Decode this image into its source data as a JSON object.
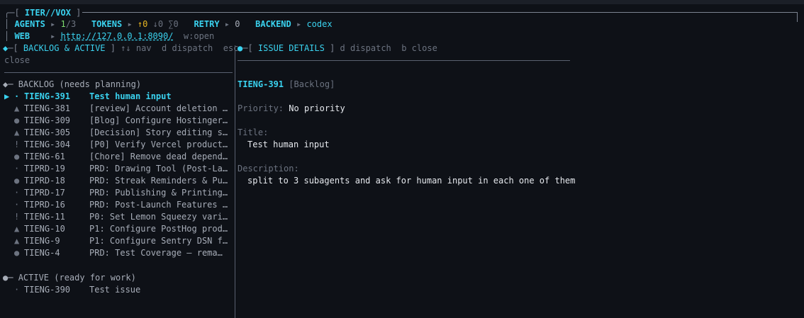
{
  "header": {
    "app_title": "ITER//VOX",
    "agents_label": "AGENTS",
    "agents_active": "1",
    "agents_total": "/3",
    "tokens_label": "TOKENS",
    "tokens_up": "↑0",
    "tokens_down": "↓0",
    "tokens_sum": "∑0",
    "retry_label": "RETRY",
    "retry_value": "0",
    "backend_label": "BACKEND",
    "backend_value": "codex",
    "web_label": "WEB",
    "web_url": "http://127.0.0.1:8090/",
    "web_hint": "w:open"
  },
  "left_panel": {
    "title": "BACKLOG & ACTIVE",
    "hint_nav": "↑↓ nav",
    "hint_dispatch": "d dispatch",
    "hint_esc": "esc",
    "hint_close": "close",
    "backlog_heading": "BACKLOG (needs planning)",
    "backlog": [
      {
        "icon": "·",
        "id": "TIENG-391",
        "title": "Test human input",
        "selected": true
      },
      {
        "icon": "▲",
        "id": "TIENG-381",
        "title": "[review] Account deletion m…",
        "selected": false
      },
      {
        "icon": "●",
        "id": "TIENG-309",
        "title": "[Blog] Configure Hostinger …",
        "selected": false
      },
      {
        "icon": "▲",
        "id": "TIENG-305",
        "title": "[Decision] Story editing sc…",
        "selected": false
      },
      {
        "icon": "!",
        "id": "TIENG-304",
        "title": "[P0] Verify Vercel producti…",
        "selected": false
      },
      {
        "icon": "●",
        "id": "TIENG-61",
        "title": "[Chore] Remove dead depende…",
        "selected": false
      },
      {
        "icon": "·",
        "id": "TIPRD-19",
        "title": "PRD: Drawing Tool (Post-Lau…",
        "selected": false
      },
      {
        "icon": "●",
        "id": "TIPRD-18",
        "title": "PRD: Streak Reminders & Pus…",
        "selected": false
      },
      {
        "icon": "·",
        "id": "TIPRD-17",
        "title": "PRD: Publishing & Printing …",
        "selected": false
      },
      {
        "icon": "·",
        "id": "TIPRD-16",
        "title": "PRD: Post-Launch Features B…",
        "selected": false
      },
      {
        "icon": "!",
        "id": "TIENG-11",
        "title": "P0: Set Lemon Squeezy varia…",
        "selected": false
      },
      {
        "icon": "▲",
        "id": "TIENG-10",
        "title": "P1: Configure PostHog produ…",
        "selected": false
      },
      {
        "icon": "▲",
        "id": "TIENG-9",
        "title": "P1: Configure Sentry DSN fo…",
        "selected": false
      },
      {
        "icon": "●",
        "id": "TIENG-4",
        "title": "PRD: Test Coverage — rema…",
        "selected": false
      }
    ],
    "active_heading": "ACTIVE (ready for work)",
    "active": [
      {
        "icon": "·",
        "id": "TIENG-390",
        "title": "Test issue"
      }
    ]
  },
  "right_panel": {
    "title": "ISSUE DETAILS",
    "hint_dispatch": "d dispatch",
    "hint_close": "b close",
    "issue_id": "TIENG-391",
    "issue_state": "[Backlog]",
    "priority_label": "Priority:",
    "priority_value": "No priority",
    "title_label": "Title:",
    "title_value": "Test human input",
    "description_label": "Description:",
    "description_value": "split to 3 subagents and ask for human input in each one of them"
  }
}
